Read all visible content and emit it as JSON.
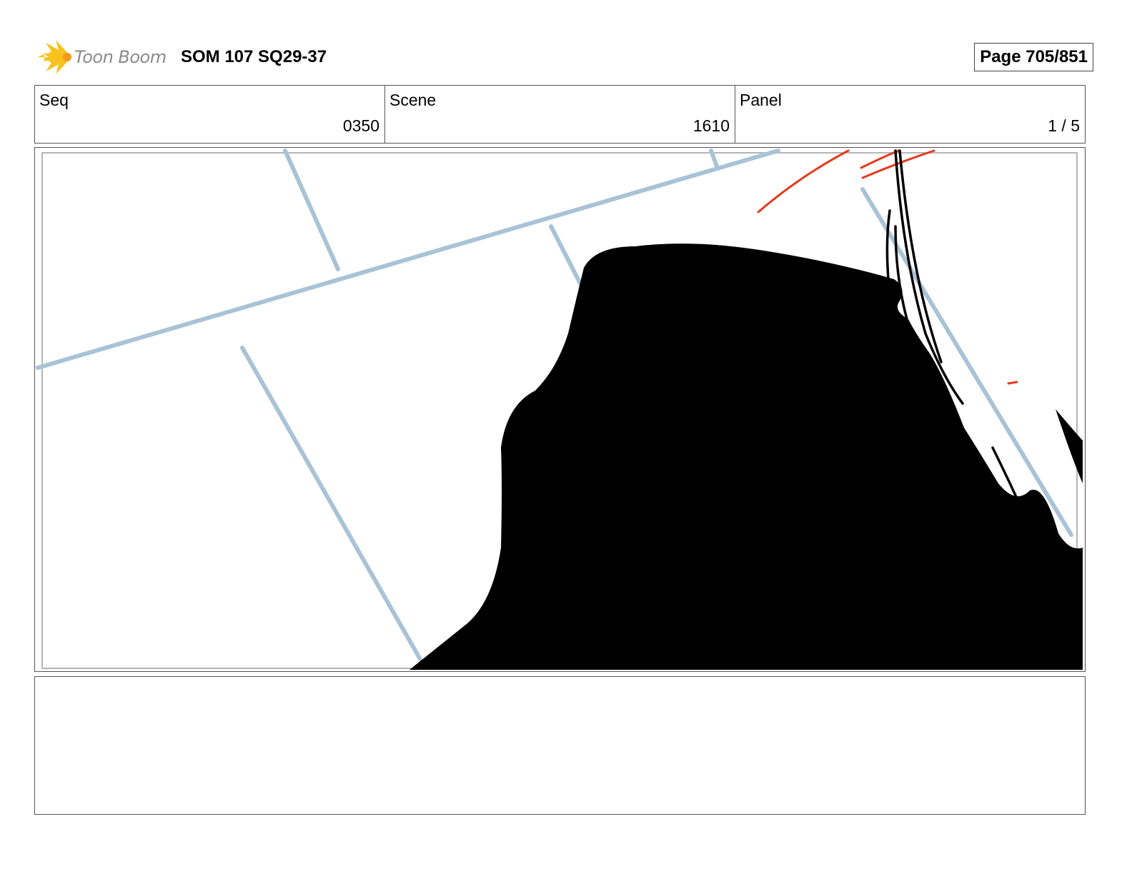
{
  "header": {
    "logo_text": "Toon Boom",
    "title": "SOM 107 SQ29-37",
    "page": "Page 705/851"
  },
  "info": {
    "seq_label": "Seq",
    "seq_value": "0350",
    "scene_label": "Scene",
    "scene_value": "1610",
    "panel_label": "Panel",
    "panel_value": "1 / 5"
  },
  "notes": {
    "text": ""
  },
  "colors": {
    "guide_line": "#a9c3d6",
    "red_sketch": "#e33a1e",
    "silhouette": "#000000",
    "logo_yellow": "#f7c21b"
  }
}
